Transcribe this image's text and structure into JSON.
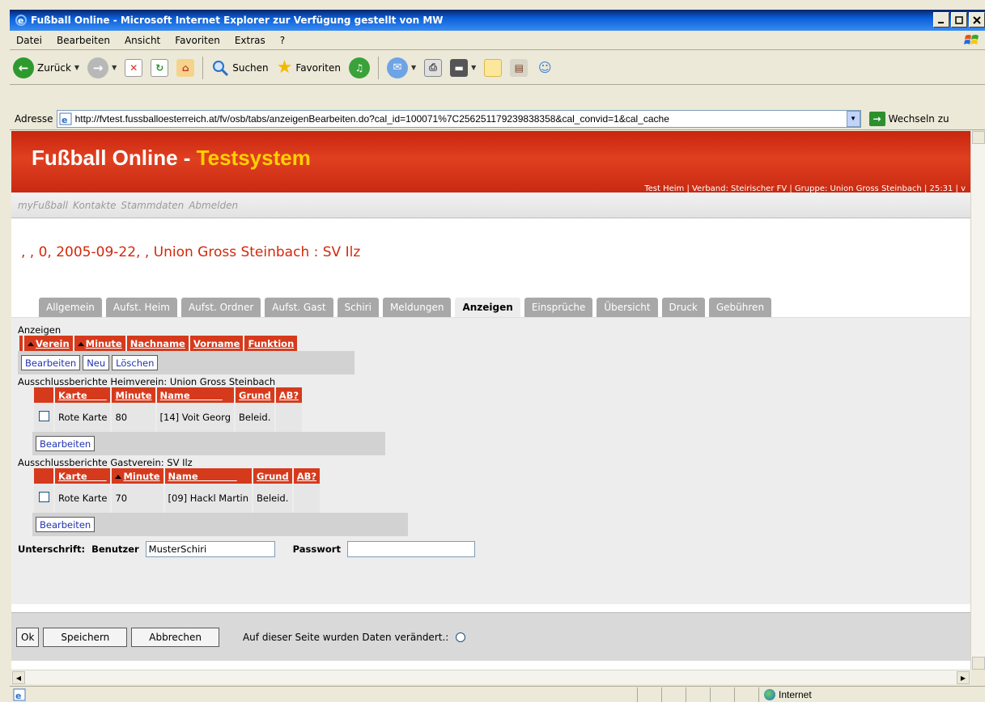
{
  "window": {
    "title": "Fußball Online - Microsoft Internet Explorer  zur Verfügung gestellt von MW"
  },
  "menu": [
    "Datei",
    "Bearbeiten",
    "Ansicht",
    "Favoriten",
    "Extras",
    "?"
  ],
  "toolbar": {
    "back_label": "Zurück",
    "search_label": "Suchen",
    "favorites_label": "Favoriten"
  },
  "address": {
    "label": "Adresse",
    "url": "http://fvtest.fussballoesterreich.at/fv/osb/tabs/anzeigenBearbeiten.do?cal_id=100071%7C256251179239838358&cal_convid=1&cal_cache",
    "go_label": "Wechseln zu"
  },
  "site": {
    "title_main": "Fußball Online - ",
    "title_highlight": "Testsystem",
    "user_info": "Test Heim | Verband: Steirischer FV | Gruppe: Union Gross Steinbach | 25:31 | v",
    "nav": [
      "myFußball",
      "Kontakte",
      "Stammdaten",
      "Abmelden"
    ]
  },
  "match": {
    "title": ", , 0, 2005-09-22, , Union Gross Steinbach : SV Ilz"
  },
  "tabs": [
    {
      "label": "Allgemein",
      "active": false
    },
    {
      "label": "Aufst. Heim",
      "active": false
    },
    {
      "label": "Aufst. Ordner",
      "active": false
    },
    {
      "label": "Aufst. Gast",
      "active": false
    },
    {
      "label": "Schiri",
      "active": false
    },
    {
      "label": "Meldungen",
      "active": false
    },
    {
      "label": "Anzeigen",
      "active": true
    },
    {
      "label": "Einsprüche",
      "active": false
    },
    {
      "label": "Übersicht",
      "active": false
    },
    {
      "label": "Druck",
      "active": false
    },
    {
      "label": "Gebühren",
      "active": false
    }
  ],
  "anzeigen": {
    "heading": "Anzeigen",
    "columns": [
      "Verein",
      "Minute",
      "Nachname",
      "Vorname",
      "Funktion"
    ],
    "buttons": [
      "Bearbeiten",
      "Neu",
      "Löschen"
    ]
  },
  "heim": {
    "heading": "Ausschlussberichte Heimverein: Union Gross Steinbach",
    "columns": [
      "Karte",
      "Minute",
      "Name",
      "Grund",
      "AB?"
    ],
    "rows": [
      {
        "karte": "Rote Karte",
        "minute": "80",
        "name": "[14] Voit Georg",
        "grund": "Beleid.",
        "ab": ""
      }
    ],
    "button": "Bearbeiten"
  },
  "gast": {
    "heading": "Ausschlussberichte Gastverein: SV Ilz",
    "columns": [
      "Karte",
      "Minute",
      "Name",
      "Grund",
      "AB?"
    ],
    "rows": [
      {
        "karte": "Rote Karte",
        "minute": "70",
        "name": "[09] Hackl Martin",
        "grund": "Beleid.",
        "ab": ""
      }
    ],
    "button": "Bearbeiten"
  },
  "signature": {
    "label": "Unterschrift:",
    "user_label": "Benutzer",
    "user_value": "MusterSchiri",
    "password_label": "Passwort",
    "password_value": ""
  },
  "bottom": {
    "ok": "Ok",
    "save": "Speichern",
    "cancel": "Abbrechen",
    "changed_text": "Auf dieser Seite wurden Daten verändert.:"
  },
  "status": {
    "zone": "Internet"
  },
  "colors": {
    "brand_red": "#d63a1c",
    "highlight_yellow": "#ffd000",
    "tab_grey": "#a8a8a8"
  }
}
